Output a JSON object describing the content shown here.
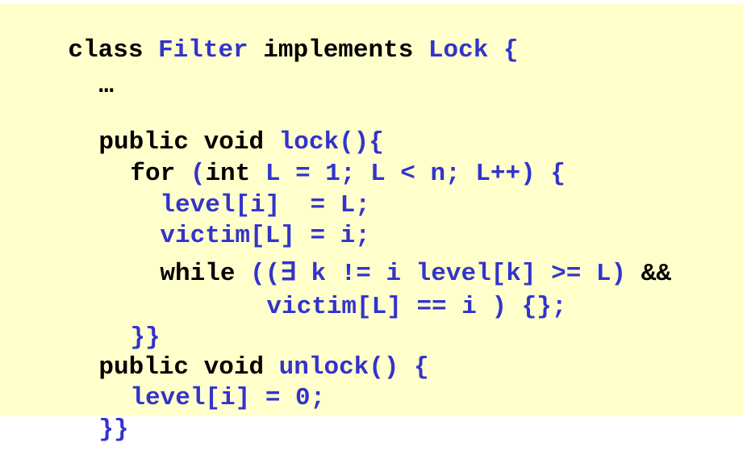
{
  "code": {
    "line1": {
      "kw1": "class",
      "name": "Filter",
      "kw2": "implements",
      "iface": "Lock",
      "brace": "{"
    },
    "line2": {
      "ellipsis": "…"
    },
    "line3": {
      "kw": "public void",
      "rest": "lock(){"
    },
    "line4": {
      "kw": "for",
      "rest1": "(",
      "kw2": "int",
      "rest2": "L = 1; L < n; L++) {"
    },
    "line5": {
      "text": "level[i]  = L;"
    },
    "line6": {
      "text": "victim[L] = i;"
    },
    "line7": {
      "kw": "while",
      "rest": "((∃ k != i level[k] >= L)",
      "op": "&&"
    },
    "line8": {
      "text": "victim[L] == i ) {};"
    },
    "line9": {
      "text": "}}"
    },
    "line10": {
      "kw": "public void",
      "rest": "unlock() {"
    },
    "line11": {
      "text": "level[i] = 0;"
    },
    "line12": {
      "text": "}}"
    }
  }
}
